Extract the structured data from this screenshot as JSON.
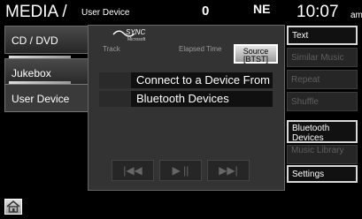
{
  "header": {
    "title": "MEDIA /",
    "subtitle": "User Device",
    "status_number": "0",
    "compass": "NE",
    "clock": "10:07",
    "clock_suffix": "am"
  },
  "tabs": [
    {
      "label": "CD / DVD",
      "active": false
    },
    {
      "label": "Jukebox",
      "active": false
    },
    {
      "label": "User Device",
      "active": true
    }
  ],
  "main": {
    "logo_text": "SYNC",
    "logo_sub": "Microsoft",
    "track_label": "Track",
    "elapsed_label": "Elapsed Time",
    "source_button": {
      "line1": "Source",
      "line2": "[BTST]"
    },
    "message_line1": "Connect to a Device From",
    "message_line2": "Bluetooth Devices",
    "transport": {
      "prev_icon": "skip-back-icon",
      "play_pause_icon": "play-pause-icon",
      "next_icon": "skip-forward-icon"
    }
  },
  "right_buttons": [
    {
      "label": "Text",
      "enabled": true
    },
    {
      "label": "Similar Music",
      "enabled": false
    },
    {
      "label": "Repeat",
      "enabled": false
    },
    {
      "label": "Shuffle",
      "enabled": false
    },
    {
      "label": "Bluetooth Devices",
      "enabled": true
    },
    {
      "label": "Music Library",
      "enabled": false
    },
    {
      "label": "Settings",
      "enabled": true
    }
  ],
  "home_icon": "home-icon"
}
